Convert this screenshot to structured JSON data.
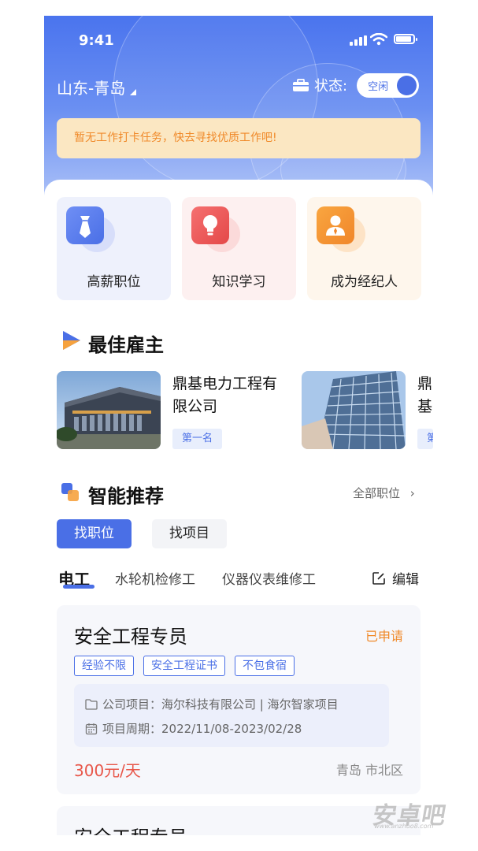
{
  "status_bar": {
    "time": "9:41"
  },
  "header": {
    "location": "山东-青岛",
    "status_label": "状态:",
    "status_value": "空闲",
    "notice": "暂无工作打卡任务，快去寻找优质工作吧!"
  },
  "quick_entries": [
    {
      "label": "高薪职位",
      "icon": "tie-icon"
    },
    {
      "label": "知识学习",
      "icon": "lightbulb-icon"
    },
    {
      "label": "成为经纪人",
      "icon": "agent-icon"
    }
  ],
  "best_employers": {
    "title": "最佳雇主",
    "items": [
      {
        "name": "鼎基电力工程有限公司",
        "badge": "第一名"
      },
      {
        "name": "鼎基",
        "badge": "第"
      }
    ]
  },
  "recommend": {
    "title": "智能推荐",
    "more_label": "全部职位",
    "tabs": [
      {
        "label": "找职位",
        "active": true
      },
      {
        "label": "找项目",
        "active": false
      }
    ],
    "categories": [
      "电工",
      "水轮机检修工",
      "仪器仪表维修工"
    ],
    "edit_label": "编辑"
  },
  "jobs": [
    {
      "title": "安全工程专员",
      "status": "已申请",
      "tags": [
        "经验不限",
        "安全工程证书",
        "不包食宿"
      ],
      "project": "公司项目：海尔科技有限公司 | 海尔智家项目",
      "period": "项目周期：2022/11/08-2023/02/28",
      "salary": "300元/天",
      "location": "青岛 市北区"
    },
    {
      "title": "安全工程专员"
    }
  ],
  "watermark": {
    "text": "安卓吧",
    "sub": "www.anzhuo8.com"
  },
  "colors": {
    "primary": "#4a6fe6",
    "warning": "#f08a2a",
    "salary": "#e8574a"
  }
}
